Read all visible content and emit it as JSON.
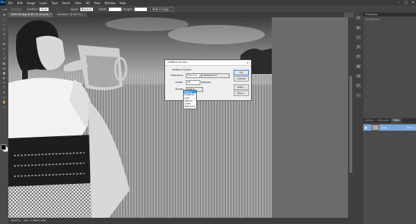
{
  "app": {
    "logo": "Ps"
  },
  "menubar": [
    "File",
    "Edit",
    "Image",
    "Layer",
    "Type",
    "Select",
    "Filter",
    "3D",
    "View",
    "Window",
    "Help"
  ],
  "window_controls": [
    "–",
    "▢",
    "✕"
  ],
  "options": {
    "mode_label": "Feather:",
    "feather": "0 px",
    "style_label": "Style:",
    "style": "Normal",
    "width_label": "Width:",
    "height_label": "Height:",
    "refine_label": "Refine Edge..."
  },
  "tabs": [
    {
      "label": "6967149.jpg @ 66.7% (Gray/8) *",
      "active": true
    },
    {
      "label": "Untitled-1 @ 66.7% (...",
      "active": false
    }
  ],
  "status": {
    "zoom": "66.67%",
    "doc": "Doc: 3.16M/3.16M"
  },
  "panels": {
    "title": "Properties",
    "sub": "No Properties",
    "channel_tabs": [
      {
        "label": "Layers",
        "active": false
      },
      {
        "label": "Channels",
        "active": false
      },
      {
        "label": "Paths",
        "active": true
      }
    ],
    "channel": {
      "name": "Gray",
      "shortcut": "Ctrl+2"
    }
  },
  "dialog": {
    "title": "Halftone Screen",
    "group": "Halftone Screen",
    "frequency_label": "Frequency:",
    "frequency": "900.211",
    "frequency_unit": "Lines/Inch",
    "angle_label": "Angle:",
    "angle": "45",
    "angle_unit": "degrees",
    "shape_label": "Shape:",
    "shape": "Line",
    "ok": "OK",
    "cancel": "Cancel",
    "load": "Load...",
    "save": "Save...",
    "shape_options": [
      "Round",
      "Elliptical",
      "Line",
      "Square",
      "Cross",
      "Diamond"
    ],
    "selected_option": "Round"
  }
}
